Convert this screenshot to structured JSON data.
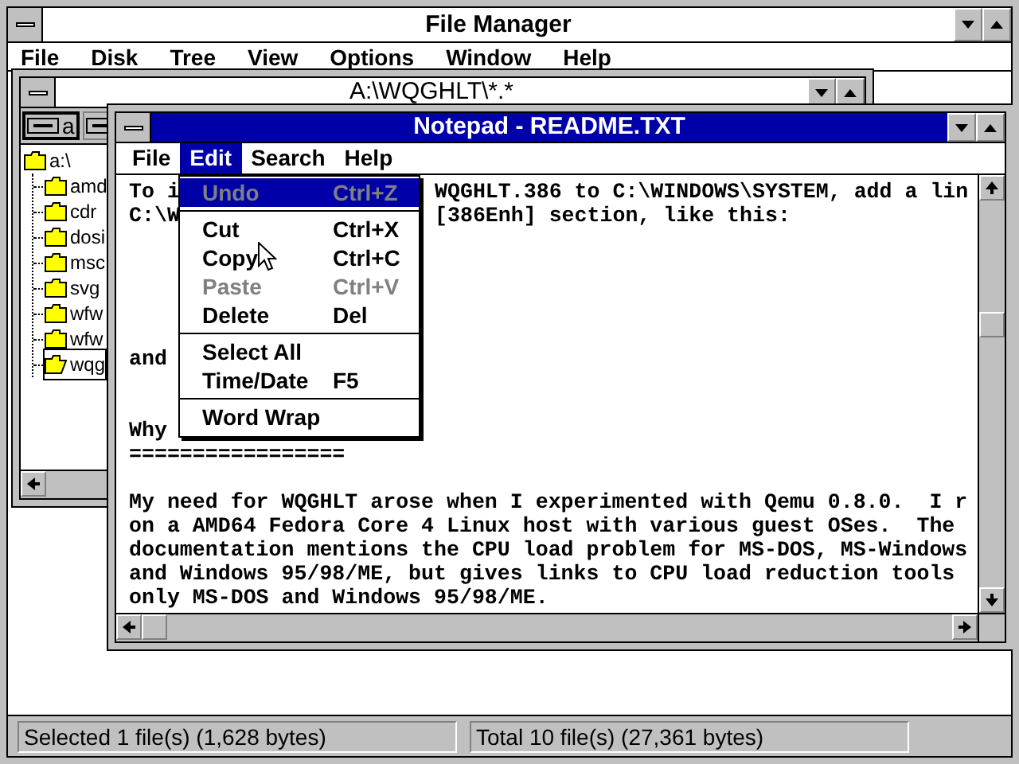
{
  "file_manager": {
    "title": "File Manager",
    "menu": [
      "File",
      "Disk",
      "Tree",
      "View",
      "Options",
      "Window",
      "Help"
    ]
  },
  "directory_window": {
    "title": "A:\\WQGHLT\\*.*",
    "drives": [
      {
        "label": "a",
        "selected": true
      },
      {
        "selected": false
      }
    ],
    "tree": {
      "label": "a:\\",
      "children": [
        {
          "label": "amd",
          "selected": false
        },
        {
          "label": "cdr",
          "selected": false
        },
        {
          "label": "dosi",
          "selected": false
        },
        {
          "label": "msc",
          "selected": false
        },
        {
          "label": "svg",
          "selected": false
        },
        {
          "label": "wfw",
          "selected": false
        },
        {
          "label": "wfw",
          "selected": false
        },
        {
          "label": "wqg",
          "selected": true
        }
      ]
    }
  },
  "notepad": {
    "title": "Notepad - README.TXT",
    "menu": [
      {
        "label": "File",
        "selected": false
      },
      {
        "label": "Edit",
        "selected": true
      },
      {
        "label": "Search",
        "selected": false
      },
      {
        "label": "Help",
        "selected": false
      }
    ],
    "edit_menu": [
      {
        "kind": "item",
        "label": "Undo",
        "shortcut": "Ctrl+Z",
        "disabled": true,
        "selected": true
      },
      {
        "kind": "separator"
      },
      {
        "kind": "item",
        "label": "Cut",
        "shortcut": "Ctrl+X",
        "disabled": false,
        "selected": false
      },
      {
        "kind": "item",
        "label": "Copy",
        "shortcut": "Ctrl+C",
        "disabled": false,
        "selected": false
      },
      {
        "kind": "item",
        "label": "Paste",
        "shortcut": "Ctrl+V",
        "disabled": true,
        "selected": false
      },
      {
        "kind": "item",
        "label": "Delete",
        "shortcut": "Del",
        "disabled": false,
        "selected": false
      },
      {
        "kind": "separator"
      },
      {
        "kind": "item",
        "label": "Select All",
        "disabled": false,
        "selected": false
      },
      {
        "kind": "item",
        "label": "Time/Date",
        "shortcut": "F5",
        "disabled": false,
        "selected": false
      },
      {
        "kind": "separator"
      },
      {
        "kind": "item",
        "label": "Word Wrap",
        "disabled": false,
        "selected": false
      }
    ],
    "paragraphs": [
      [
        {
          "text": "To i",
          "after_menu": "WQGHLT.386 to C:\\WINDOWS\\SYSTEM, add a lin"
        },
        {
          "text": "C:\\W",
          "after_menu": "[386Enh] section, like this:"
        }
      ],
      [
        {
          "text": "and"
        }
      ],
      [
        {
          "text": "Why"
        },
        {
          "text": "================="
        }
      ],
      [
        {
          "text": "My need for WQGHLT arose when I experimented with Qemu 0.8.0.  I r"
        },
        {
          "text": "on a AMD64 Fedora Core 4 Linux host with various guest OSes.  The"
        },
        {
          "text": "documentation mentions the CPU load problem for MS-DOS, MS-Windows"
        },
        {
          "text": "and Windows 95/98/ME, but gives links to CPU load reduction tools"
        },
        {
          "text": "only MS-DOS and Windows 95/98/ME."
        }
      ]
    ]
  },
  "status_bar": [
    "Selected 1 file(s) (1,628 bytes)",
    "Total 10 file(s) (27,361 bytes)"
  ]
}
